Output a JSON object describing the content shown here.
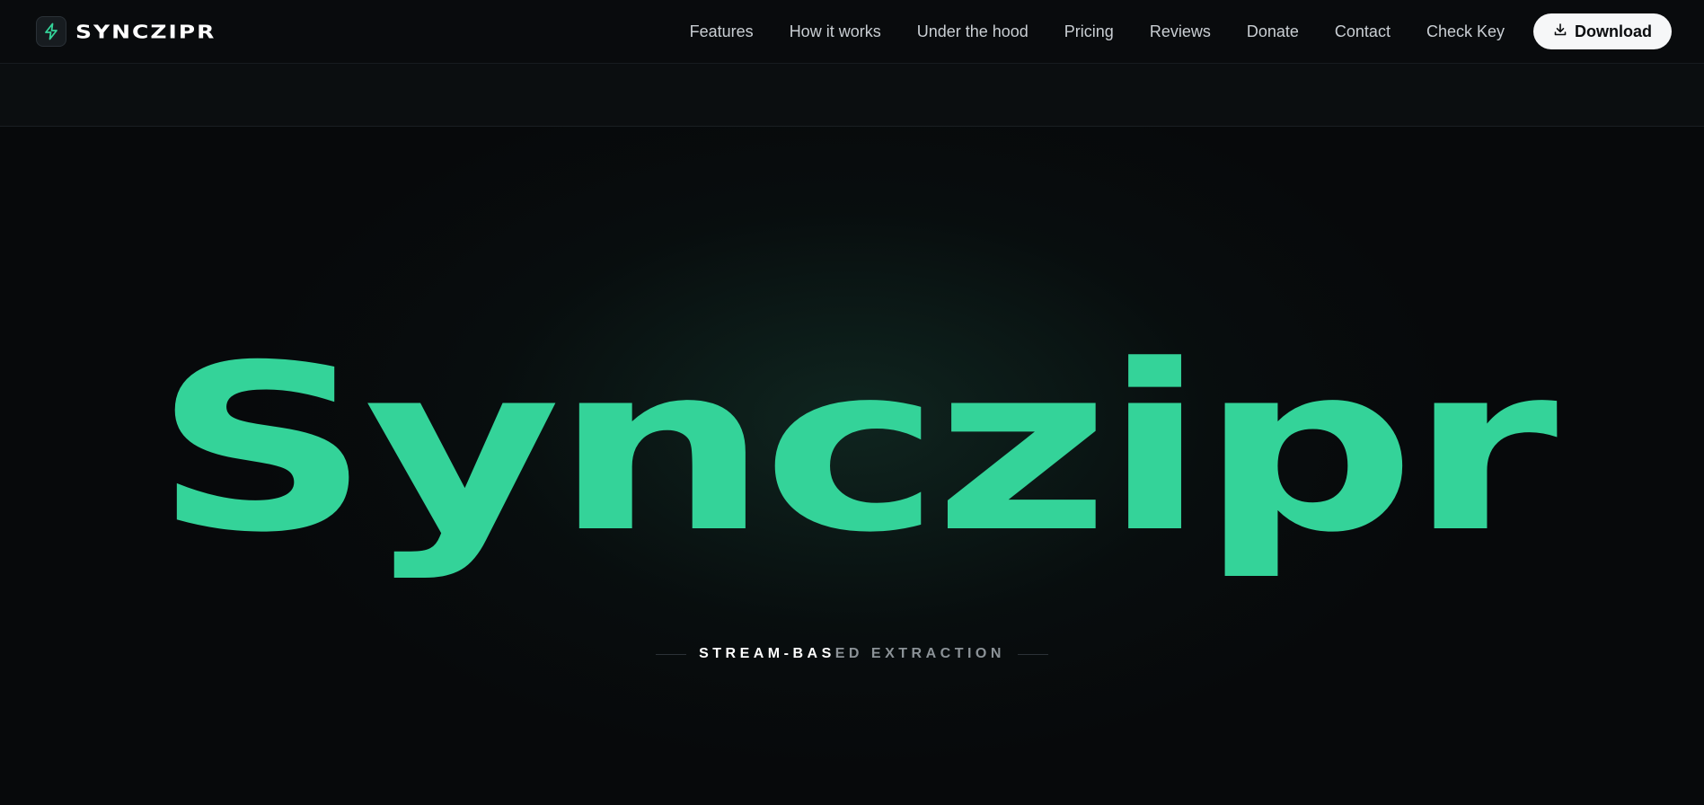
{
  "brand": {
    "name": "SYNCZIPR",
    "logo_icon": "lightning-bolt-icon",
    "accent": "#34d399"
  },
  "nav": {
    "links": [
      {
        "label": "Features"
      },
      {
        "label": "How it works"
      },
      {
        "label": "Under the hood"
      },
      {
        "label": "Pricing"
      },
      {
        "label": "Reviews"
      },
      {
        "label": "Donate"
      },
      {
        "label": "Contact"
      },
      {
        "label": "Check Key"
      }
    ],
    "download_label": "Download",
    "download_icon": "download-icon"
  },
  "hero": {
    "title": "Synczipr",
    "tagline_bright": "STREAM-BAS",
    "tagline_dim": "ED EXTRACTION",
    "title_color": "#34d399"
  }
}
